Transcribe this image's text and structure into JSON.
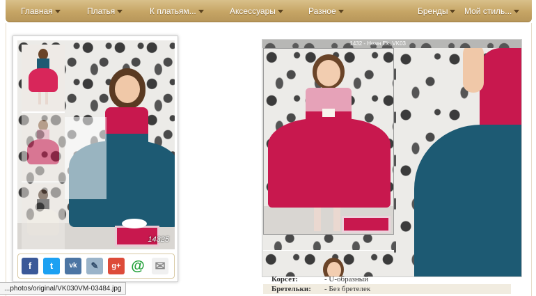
{
  "nav": {
    "items": [
      {
        "label": "Главная",
        "has_dropdown": true
      },
      {
        "label": "Платья",
        "has_dropdown": true
      },
      {
        "label": "К платьям...",
        "has_dropdown": true
      },
      {
        "label": "Аксессуары",
        "has_dropdown": true
      },
      {
        "label": "Разное",
        "has_dropdown": true
      },
      {
        "label": "Бренды",
        "has_dropdown": true
      },
      {
        "label": "Мой стиль...",
        "has_dropdown": true
      }
    ],
    "background": "#c6a565",
    "text_color": "#ffffff"
  },
  "product": {
    "photo_code": "14325",
    "thumbnails_count": 3
  },
  "share": {
    "buttons": [
      {
        "icon": "facebook-icon",
        "glyph": "f",
        "color": "#3b5998"
      },
      {
        "icon": "twitter-icon",
        "glyph": "t",
        "color": "#1da1f2"
      },
      {
        "icon": "vk-icon",
        "glyph": "vk",
        "color": "#4c75a3"
      },
      {
        "icon": "livejournal-icon",
        "glyph": "✎",
        "color": "#9bb4c9"
      },
      {
        "icon": "google-plus-icon",
        "glyph": "g+",
        "color": "#dd4b39"
      },
      {
        "icon": "mail-at-icon",
        "glyph": "@",
        "color": "#21a038"
      },
      {
        "icon": "email-envelope-icon",
        "glyph": "✉",
        "color": "#c8c8c8"
      }
    ]
  },
  "preview": {
    "caption": "1432 - Немн Ek, VK03"
  },
  "specs": [
    {
      "key": "Корсет:",
      "value": "- U-образный"
    },
    {
      "key": "Бретельки:",
      "value": "- Без бретелек"
    }
  ],
  "status": {
    "url": "...photos/original/VK030VM-03484.jpg"
  },
  "colors": {
    "dress_pink": "#c8184e",
    "dress_teal": "#1d5a73",
    "lace_pink": "#e6a2b8",
    "belt_teal": "#2a6f86"
  }
}
